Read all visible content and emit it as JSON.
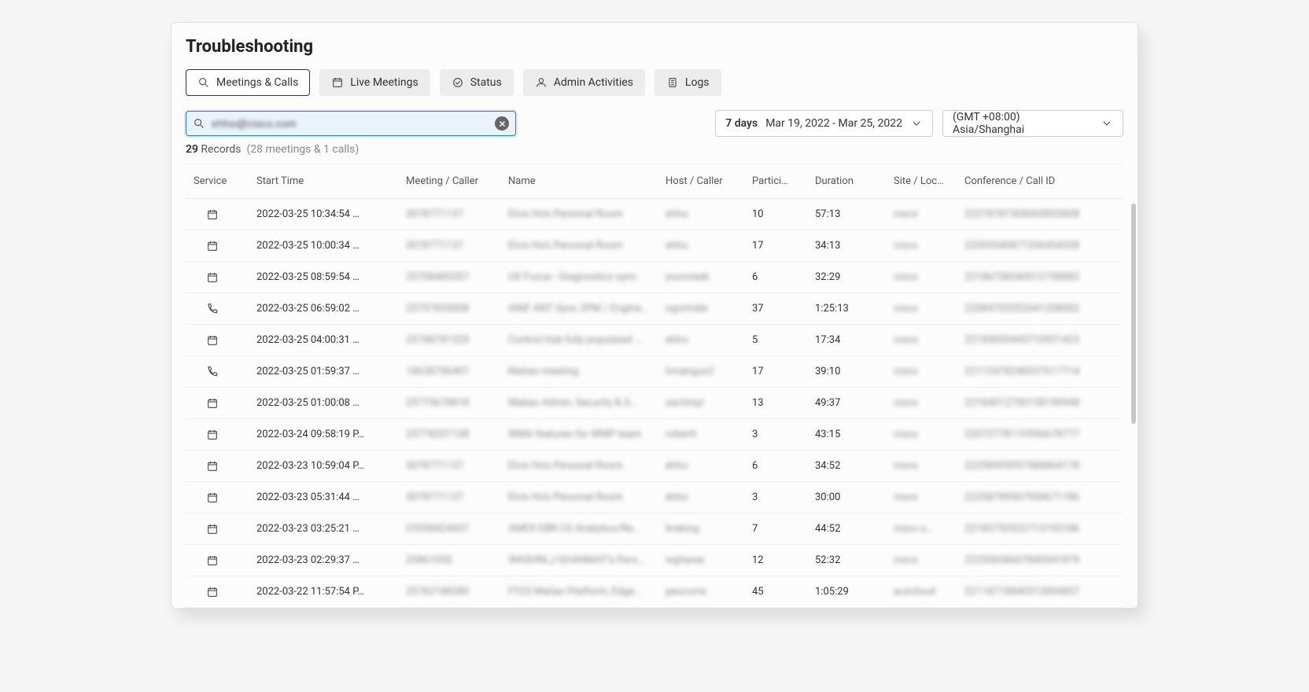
{
  "title": "Troubleshooting",
  "tabs": [
    {
      "label": "Meetings & Calls",
      "icon": "search",
      "active": true
    },
    {
      "label": "Live Meetings",
      "icon": "calendar",
      "active": false
    },
    {
      "label": "Status",
      "icon": "check-circle",
      "active": false
    },
    {
      "label": "Admin Activities",
      "icon": "user",
      "active": false
    },
    {
      "label": "Logs",
      "icon": "file",
      "active": false
    }
  ],
  "search": {
    "value": "ehho@cisco.com"
  },
  "date_selector": {
    "preset": "7 days",
    "range": "Mar 19, 2022 - Mar 25, 2022"
  },
  "timezone": "(GMT +08:00) Asia/Shanghai",
  "records": {
    "count": "29",
    "suffix": "Records",
    "detail": "(28 meetings & 1 calls)"
  },
  "columns": {
    "service": "Service",
    "start": "Start Time",
    "meeting": "Meeting / Caller",
    "name": "Name",
    "host": "Host / Caller",
    "participants": "Partici…",
    "duration": "Duration",
    "site": "Site / Loc…",
    "conf": "Conference / Call ID"
  },
  "rows": [
    {
      "service": "meeting",
      "start": "2022-03-25 10:34:54 …",
      "meeting": "3078771137",
      "name": "Elvis Ho's Personal Room",
      "host": "ehho",
      "participants": "10",
      "duration": "57:13",
      "site": "cisco",
      "conf": "22278787308060003808"
    },
    {
      "service": "meeting",
      "start": "2022-03-25 10:00:34 …",
      "meeting": "3078771137",
      "name": "Elvis Ho's Personal Room",
      "host": "ehho",
      "participants": "17",
      "duration": "34:13",
      "site": "cisco",
      "conf": "22095540871336454338"
    },
    {
      "service": "meeting",
      "start": "2022-03-25 08:59:54 …",
      "meeting": "25708485357",
      "name": "UX Focus - Diagnostics sync",
      "host": "yoonneek",
      "participants": "6",
      "duration": "32:29",
      "site": "cisco",
      "conf": "22186738540012758882"
    },
    {
      "service": "call",
      "start": "2022-03-25 06:59:02 …",
      "meeting": "25757835008",
      "name": "IANF ANT Sync 2PM / Engine…",
      "host": "ngorindie",
      "participants": "37",
      "duration": "1:25:13",
      "site": "cisco",
      "conf": "22084702052641208002"
    },
    {
      "service": "meeting",
      "start": "2022-03-25 04:00:31 …",
      "meeting": "25788781520",
      "name": "Control Hub fully populated …",
      "host": "ehho",
      "participants": "5",
      "duration": "17:34",
      "site": "cisco",
      "conf": "22185059445710921423"
    },
    {
      "service": "call",
      "start": "2022-03-25 01:59:37 …",
      "meeting": "18638706407",
      "name": "Maliao meeting",
      "host": "hmangus2",
      "participants": "17",
      "duration": "39:10",
      "site": "cisco",
      "conf": "22112478248537617714"
    },
    {
      "service": "meeting",
      "start": "2022-03-25 01:00:08 …",
      "meeting": "25775678818",
      "name": "Maliao Admin, Security & S…",
      "host": "sachinpi",
      "participants": "13",
      "duration": "49:37",
      "site": "cisco",
      "conf": "22184012750158190948"
    },
    {
      "service": "meeting",
      "start": "2022-03-24 09:58:19 P…",
      "meeting": "25778207138",
      "name": "WMA features for WMP team",
      "host": "robertt",
      "participants": "3",
      "duration": "43:15",
      "site": "cisco",
      "conf": "22072778110596678777"
    },
    {
      "service": "meeting",
      "start": "2022-03-23 10:59:04 P…",
      "meeting": "3078771137",
      "name": "Elvis Ho's Personal Room",
      "host": "ehho",
      "participants": "6",
      "duration": "34:52",
      "site": "cisco",
      "conf": "22258905057588864178"
    },
    {
      "service": "meeting",
      "start": "2022-03-23 05:31:44 …",
      "meeting": "3078771137",
      "name": "Elvis Ho's Personal Room",
      "host": "ehho",
      "participants": "3",
      "duration": "30:00",
      "site": "cisco",
      "conf": "22258789507938671186"
    },
    {
      "service": "meeting",
      "start": "2022-03-23 03:25:21 …",
      "meeting": "25558424437",
      "name": "AMEX EBR CX Analytics/Re…",
      "host": "braking",
      "participants": "7",
      "duration": "44:52",
      "site": "cisco s…",
      "conf": "22185753522713193186"
    },
    {
      "service": "meeting",
      "start": "2022-03-23 02:29:37 …",
      "meeting": "25861050",
      "name": "WASHNLJ GHANMAT's Pers…",
      "host": "wgharee",
      "participants": "12",
      "duration": "52:32",
      "site": "cisco",
      "conf": "22250698607840541879"
    },
    {
      "service": "meeting",
      "start": "2022-03-22 11:57:54 P…",
      "meeting": "25782188280",
      "name": "FY23 Maliao Platform, Edge…",
      "host": "paucorre",
      "participants": "45",
      "duration": "1:05:29",
      "site": "acecloud",
      "conf": "22118718840312894857"
    }
  ]
}
